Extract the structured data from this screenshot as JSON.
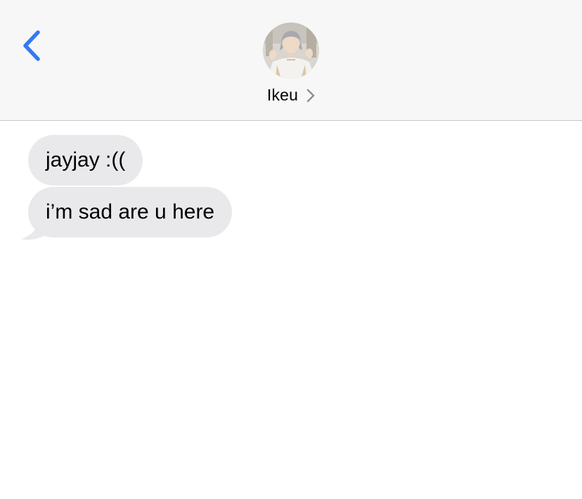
{
  "header": {
    "back_icon": "chevron-left-icon",
    "contact_name": "Ikeu",
    "contact_chevron_icon": "chevron-right-icon",
    "avatar_icon": "contact-photo",
    "accent_color": "#3478f6"
  },
  "messages": [
    {
      "direction": "incoming",
      "text": "jayjay :(("
    },
    {
      "direction": "incoming",
      "text": "i’m sad are u here"
    }
  ],
  "colors": {
    "incoming_bubble": "#e9e9eb",
    "header_background": "#f7f7f7",
    "background": "#ffffff"
  }
}
